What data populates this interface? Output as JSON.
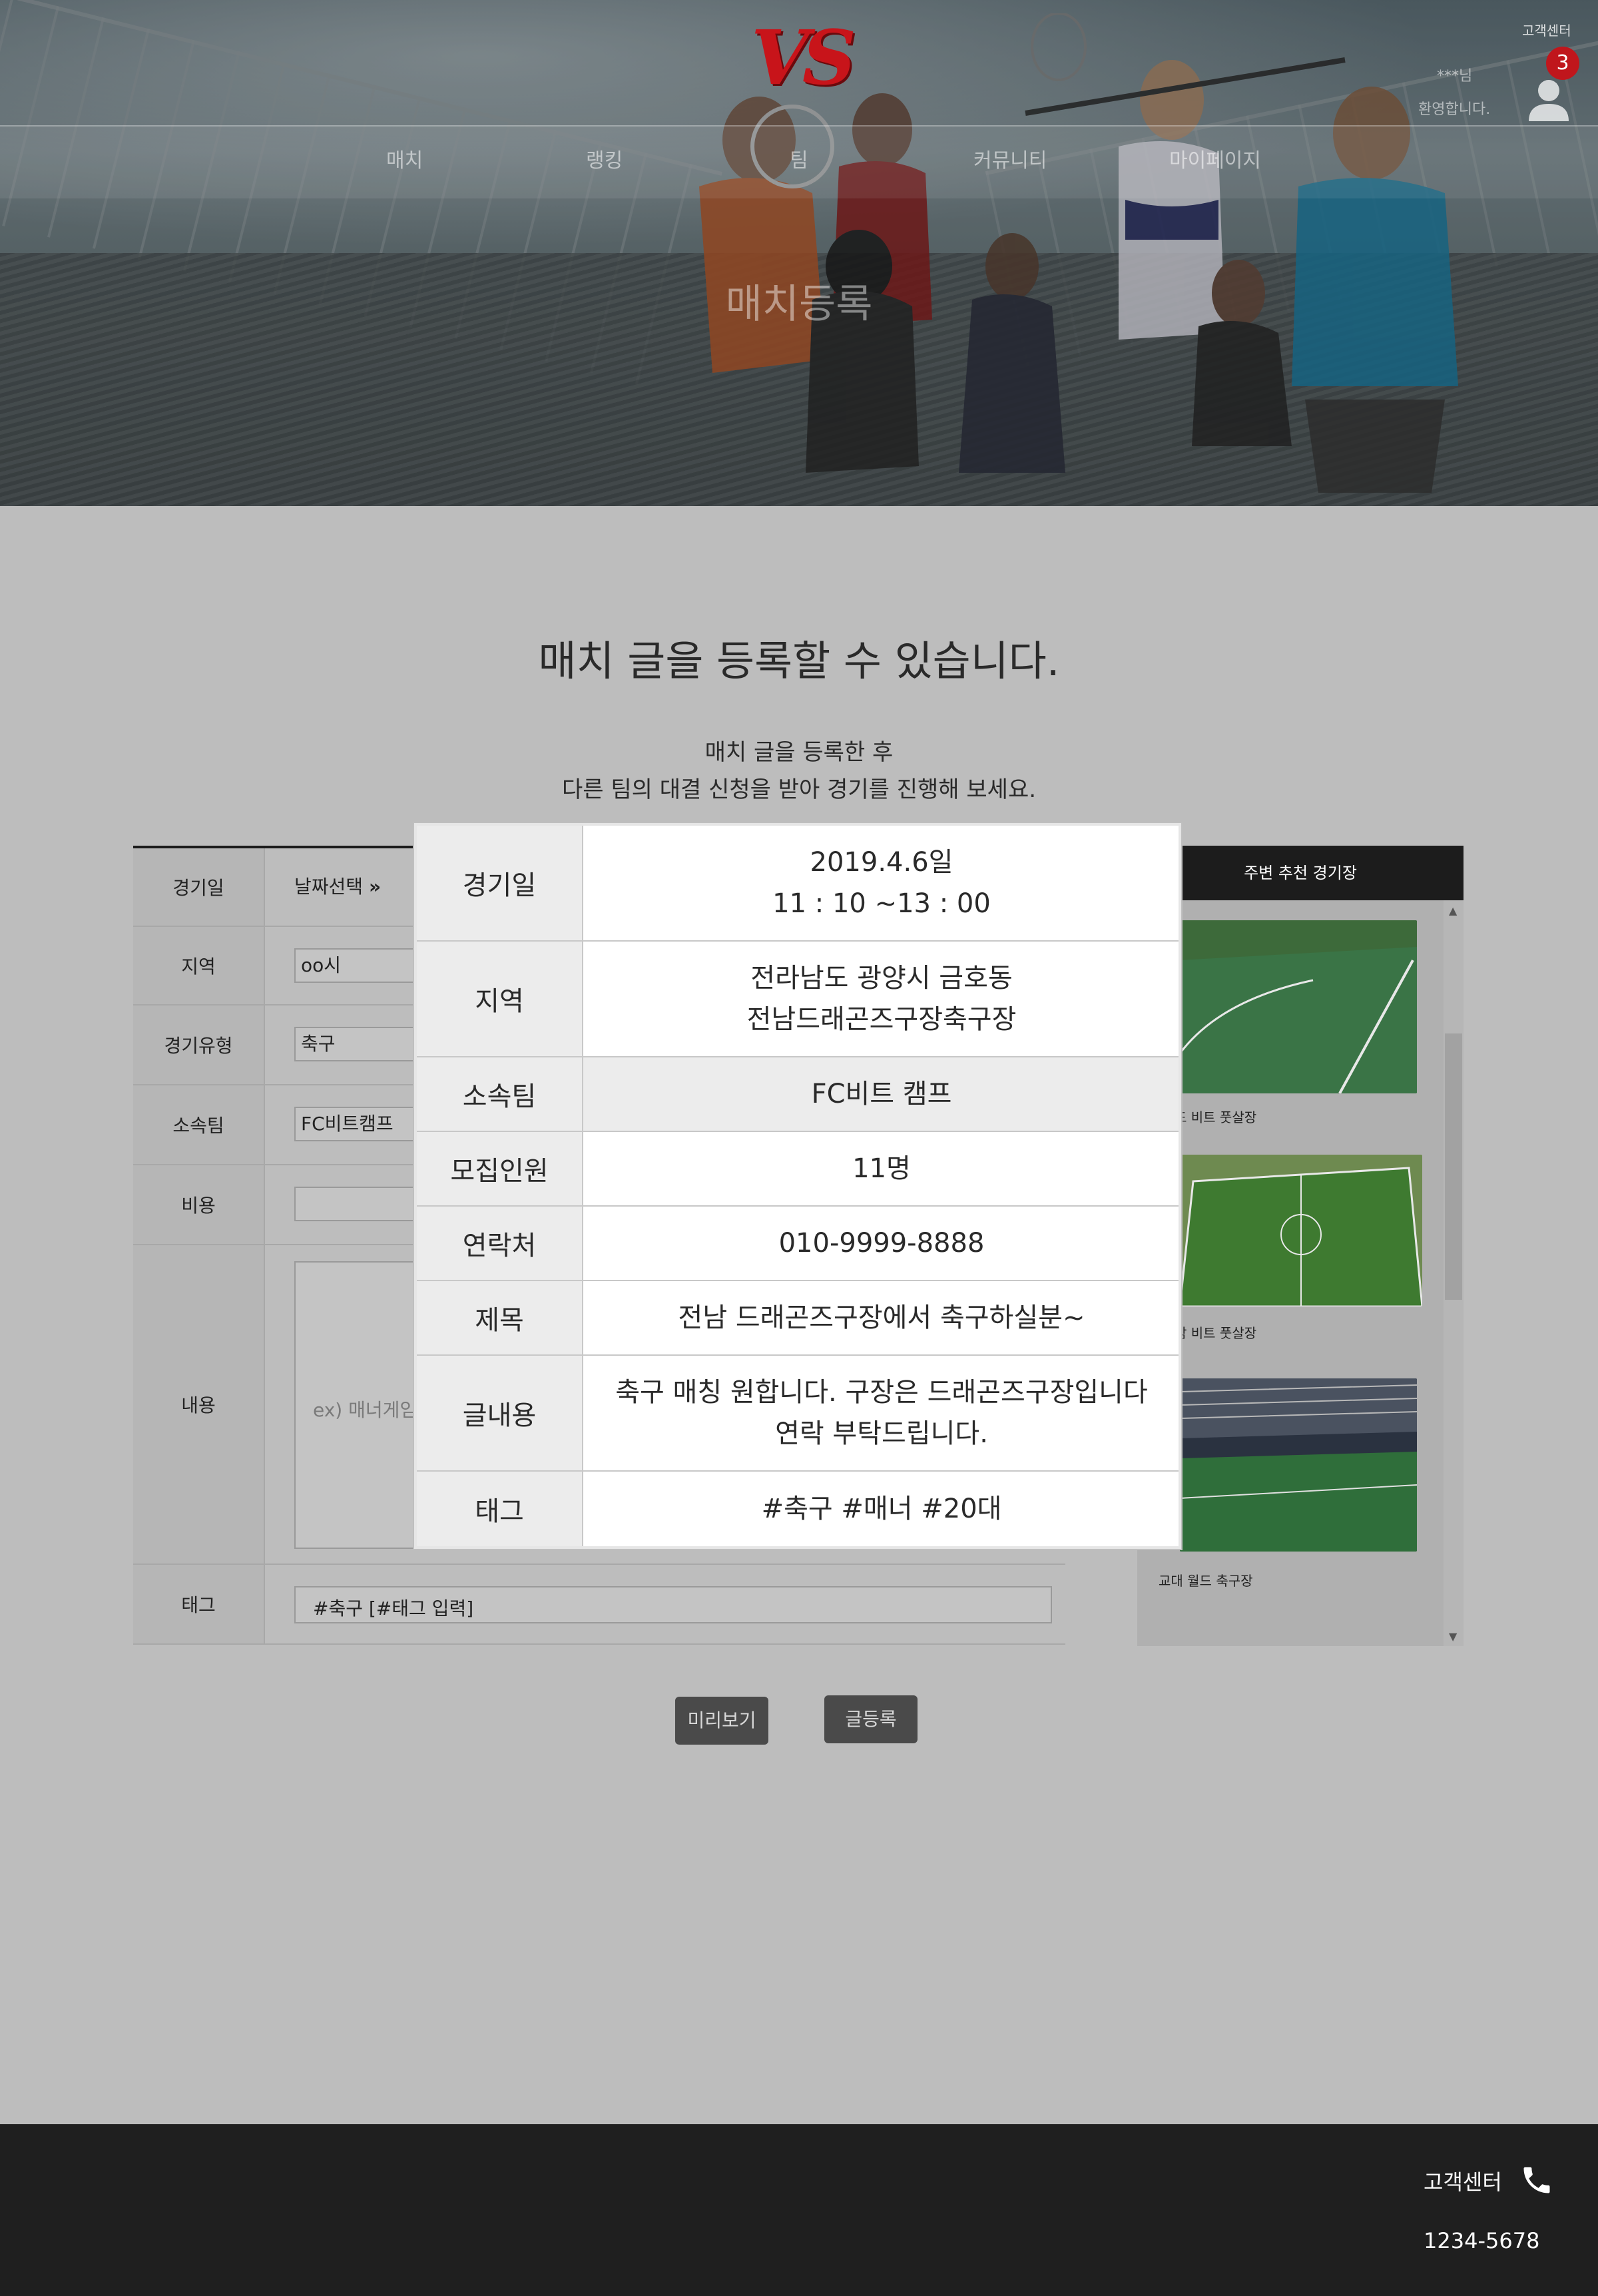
{
  "header": {
    "logo": "VS",
    "customer_center": "고객센터",
    "user_name": "***님",
    "user_welcome": "환영합니다.",
    "notification_count": "3",
    "nav": [
      "매치",
      "랭킹",
      "팀",
      "커뮤니티",
      "마이페이지"
    ],
    "hero_title": "매치등록"
  },
  "main": {
    "heading": "매치 글을 등록할 수 있습니다.",
    "sub_line1": "매치 글을 등록한 후",
    "sub_line2": "다른 팀의 대결 신청을 받아 경기를 진행해 보세요."
  },
  "form": {
    "date_label": "경기일",
    "date_select": "날짜선택",
    "region_label": "지역",
    "region_value": "oo시",
    "type_label": "경기유형",
    "type_value": "축구",
    "team_label": "소속팀",
    "team_value": "FC비트캠프",
    "cost_label": "비용",
    "content_label": "내용",
    "content_placeholder": "ex) 매너게임",
    "tag_label": "태그",
    "tag_value": "#축구 [#태그 입력]"
  },
  "sidebar": {
    "title": "주변 추천 경기장",
    "stadiums": [
      {
        "name": "드 비트 풋살장"
      },
      {
        "name": "남 비트 풋살장"
      },
      {
        "name": "교대 월드 축구장"
      }
    ]
  },
  "buttons": {
    "preview": "미리보기",
    "submit": "글등록"
  },
  "modal": {
    "rows": [
      {
        "label": "경기일",
        "lines": [
          "2019.4.6일",
          "11 : 10 ~13 : 00"
        ]
      },
      {
        "label": "지역",
        "lines": [
          "전라남도 광양시 금호동",
          "전남드래곤즈구장축구장"
        ]
      },
      {
        "label": "소속팀",
        "lines": [
          "FC비트 캠프"
        ]
      },
      {
        "label": "모집인원",
        "lines": [
          "11명"
        ]
      },
      {
        "label": "연락처",
        "lines": [
          "010-9999-8888"
        ]
      },
      {
        "label": "제목",
        "lines": [
          "전남 드래곤즈구장에서 축구하실분~"
        ]
      },
      {
        "label": "글내용",
        "lines": [
          "축구 매칭 원합니다. 구장은 드래곤즈구장입니다",
          "연락 부탁드립니다."
        ]
      },
      {
        "label": "태그",
        "lines": [
          "#축구 #매너 #20대"
        ]
      }
    ]
  },
  "footer": {
    "customer_center": "고객센터",
    "phone": "1234-5678"
  },
  "colors": {
    "accent": "#c0161c",
    "overlay": "#bdbdbd",
    "footer": "#1f1f1f"
  }
}
